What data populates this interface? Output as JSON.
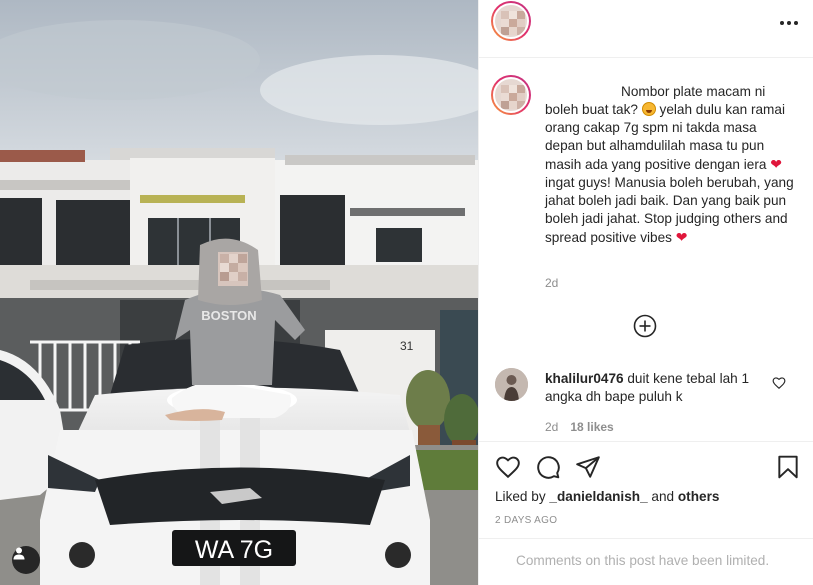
{
  "post": {
    "photo": {
      "alt": "",
      "plate_text": "WA 7G",
      "sweater_text": "BOSTON",
      "house_number": "31"
    },
    "header": {
      "avatar_icon": "profile-avatar-blurred",
      "more_icon": "more-options-icon"
    },
    "caption": {
      "line1": "Nombor plate macam ni",
      "part1": "boleh buat tak? ",
      "part2": " yelah dulu kan ramai orang cakap 7g spm ni takda masa depan but alhamdulilah masa tu pun masih ada yang positive dengan iera ",
      "part3": " ingat guys! Manusia boleh berubah, yang jahat boleh jadi baik. Dan yang baik pun boleh jadi jahat. Stop judging others and spread positive vibes ",
      "heart_glyph": "❤",
      "time": "2d"
    },
    "comment": {
      "username": "khalilur0476",
      "text": " duit kene tebal lah 1 angka dh bape puluh k",
      "time": "2d",
      "likes": "18 likes"
    },
    "likes": {
      "prefix": "Liked by ",
      "user": "_danieldanish_",
      "mid": " and ",
      "others": "others"
    },
    "date": "2 DAYS AGO",
    "comments_limited": "Comments on this post have been limited.",
    "colors": {
      "text": "#262626",
      "muted": "#8e8e8e",
      "heart": "#e0163b",
      "border": "#efefef",
      "story_ring": "#e1306c"
    }
  }
}
